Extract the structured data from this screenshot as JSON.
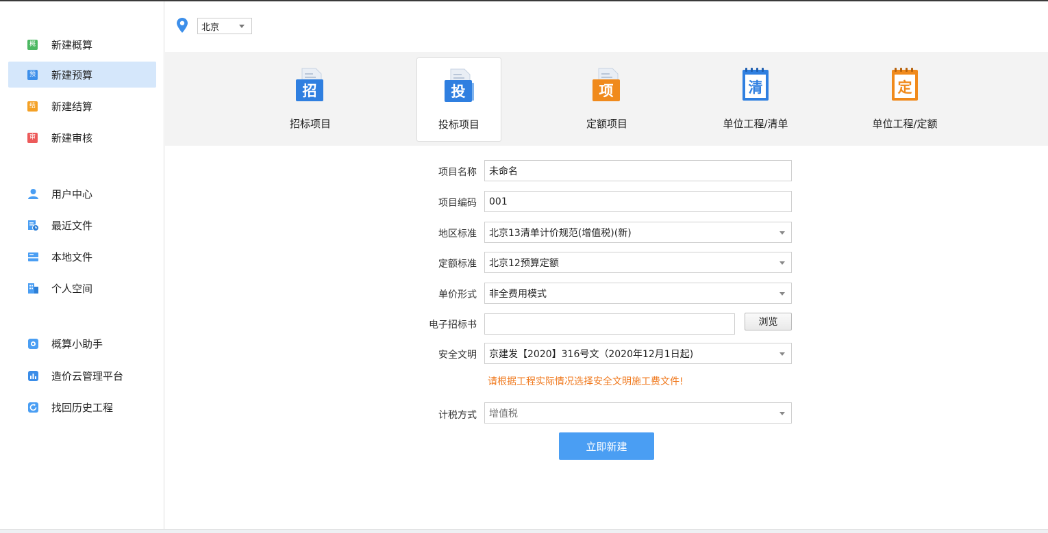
{
  "sidebar": {
    "groups": [
      [
        {
          "label": "新建概算",
          "badge": "概",
          "color": "#4cb862",
          "active": false
        },
        {
          "label": "新建预算",
          "badge": "预",
          "color": "#3d8fea",
          "active": true
        },
        {
          "label": "新建结算",
          "badge": "结",
          "color": "#f4a126",
          "active": false
        },
        {
          "label": "新建审核",
          "badge": "审",
          "color": "#ec5a5a",
          "active": false
        }
      ],
      [
        {
          "label": "用户中心",
          "icon": "user-icon"
        },
        {
          "label": "最近文件",
          "icon": "recent-files-icon"
        },
        {
          "label": "本地文件",
          "icon": "local-files-icon"
        },
        {
          "label": "个人空间",
          "icon": "personal-space-icon"
        }
      ],
      [
        {
          "label": "概算小助手",
          "icon": "assistant-icon"
        },
        {
          "label": "造价云管理平台",
          "icon": "cloud-platform-icon"
        },
        {
          "label": "找回历史工程",
          "icon": "history-icon"
        }
      ]
    ]
  },
  "region": {
    "selected": "北京"
  },
  "project_types": [
    {
      "label": "招标项目",
      "glyph": "招",
      "color": "#2f7fe0",
      "active": false
    },
    {
      "label": "投标项目",
      "glyph": "投",
      "color": "#2f7fe0",
      "active": true
    },
    {
      "label": "定额项目",
      "glyph": "项",
      "color": "#f08a1c",
      "active": false
    },
    {
      "label": "单位工程/清单",
      "glyph": "清",
      "color": "#2f7fe0",
      "active": false
    },
    {
      "label": "单位工程/定额",
      "glyph": "定",
      "color": "#f08a1c",
      "active": false
    }
  ],
  "form": {
    "project_name": {
      "label": "项目名称",
      "value": "未命名"
    },
    "project_code": {
      "label": "项目编码",
      "value": "001"
    },
    "region_standard": {
      "label": "地区标准",
      "value": "北京13清单计价规范(增值税)(新)"
    },
    "quota_standard": {
      "label": "定额标准",
      "value": "北京12预算定额"
    },
    "unit_price_form": {
      "label": "单价形式",
      "value": "非全费用模式"
    },
    "e_tender": {
      "label": "电子招标书",
      "value": "",
      "browse_label": "浏览"
    },
    "safety": {
      "label": "安全文明",
      "value": "京建发【2020】316号文（2020年12月1日起)"
    },
    "warning": "请根据工程实际情况选择安全文明施工费文件!",
    "tax_method": {
      "label": "计税方式",
      "value": "增值税"
    },
    "submit_label": "立即新建"
  }
}
